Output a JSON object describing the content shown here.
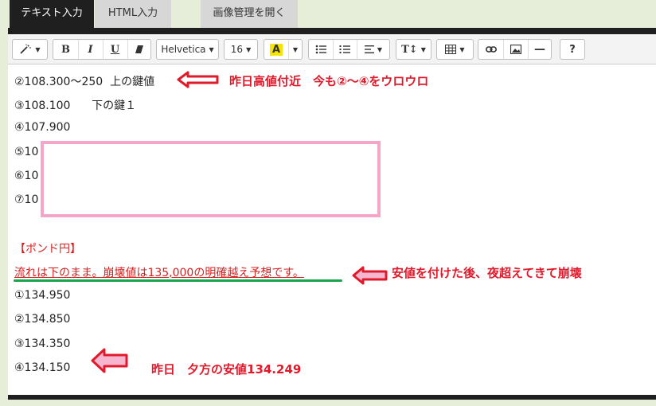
{
  "tabs": [
    {
      "label": "テキスト入力"
    },
    {
      "label": "HTML入力"
    },
    {
      "label": "画像管理を開く"
    }
  ],
  "toolbar": {
    "font_family": "Helvetica",
    "font_size": "16",
    "bold": "B",
    "italic": "I",
    "underline": "U",
    "highlight": "A",
    "text_height": "T↕",
    "help": "?",
    "hr": "—"
  },
  "lines": {
    "l1": "②108.300〜250  上の鍵値",
    "l2": "③108.100      下の鍵１",
    "l3": "④107.900",
    "l4": "⑤10",
    "l5": "⑥10",
    "l6": "⑦10",
    "l7": "【ポンド円】",
    "l8": "流れは下のまま。崩壊値は135,000の明確越え予想です。",
    "l9": "①134.950",
    "l10": "②134.850",
    "l11": "③134.350",
    "l12": "④134.150"
  },
  "annotations": {
    "a1": "昨日高値付近　今も②〜④をウロウロ",
    "a2": "安値を付けた後、夜超えてきて崩壊",
    "a3": "昨日　夕方の安値134.249"
  },
  "colors": {
    "accent_red": "#e0192b",
    "pink_box": "#f5a6c8",
    "green_underline": "#19a34b",
    "tab_active": "#1f1f1f"
  }
}
